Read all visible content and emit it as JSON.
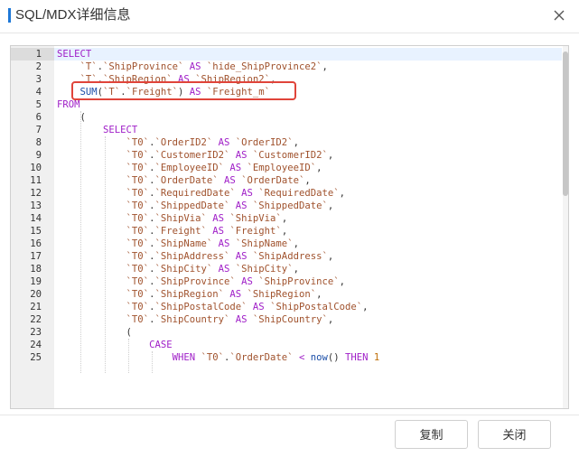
{
  "dialog": {
    "title": "SQL/MDX详细信息",
    "copy_label": "复制",
    "close_label": "关闭"
  },
  "editor": {
    "lines": [
      [
        [
          "kw",
          "SELECT"
        ]
      ],
      [
        [
          "op",
          "    "
        ],
        [
          "id",
          "`T`"
        ],
        [
          "op",
          "."
        ],
        [
          "id",
          "`ShipProvince`"
        ],
        [
          "op",
          " "
        ],
        [
          "kw",
          "AS"
        ],
        [
          "op",
          " "
        ],
        [
          "id",
          "`hide_ShipProvince2`"
        ],
        [
          "op",
          ","
        ]
      ],
      [
        [
          "op",
          "    "
        ],
        [
          "id",
          "`T`"
        ],
        [
          "op",
          "."
        ],
        [
          "id",
          "`ShipRegion`"
        ],
        [
          "op",
          " "
        ],
        [
          "kw",
          "AS"
        ],
        [
          "op",
          " "
        ],
        [
          "id",
          "`ShipRegion2`"
        ],
        [
          "op",
          ","
        ]
      ],
      [
        [
          "op",
          "    "
        ],
        [
          "fn",
          "SUM"
        ],
        [
          "op",
          "("
        ],
        [
          "id",
          "`T`"
        ],
        [
          "op",
          "."
        ],
        [
          "id",
          "`Freight`"
        ],
        [
          "op",
          ") "
        ],
        [
          "kw",
          "AS"
        ],
        [
          "op",
          " "
        ],
        [
          "id",
          "`Freight_m`"
        ]
      ],
      [
        [
          "kw",
          "FROM"
        ]
      ],
      [
        [
          "op",
          "    ("
        ]
      ],
      [
        [
          "op",
          "        "
        ],
        [
          "kw",
          "SELECT"
        ]
      ],
      [
        [
          "op",
          "            "
        ],
        [
          "id",
          "`T0`"
        ],
        [
          "op",
          "."
        ],
        [
          "id",
          "`OrderID2`"
        ],
        [
          "op",
          " "
        ],
        [
          "kw",
          "AS"
        ],
        [
          "op",
          " "
        ],
        [
          "id",
          "`OrderID2`"
        ],
        [
          "op",
          ","
        ]
      ],
      [
        [
          "op",
          "            "
        ],
        [
          "id",
          "`T0`"
        ],
        [
          "op",
          "."
        ],
        [
          "id",
          "`CustomerID2`"
        ],
        [
          "op",
          " "
        ],
        [
          "kw",
          "AS"
        ],
        [
          "op",
          " "
        ],
        [
          "id",
          "`CustomerID2`"
        ],
        [
          "op",
          ","
        ]
      ],
      [
        [
          "op",
          "            "
        ],
        [
          "id",
          "`T0`"
        ],
        [
          "op",
          "."
        ],
        [
          "id",
          "`EmployeeID`"
        ],
        [
          "op",
          " "
        ],
        [
          "kw",
          "AS"
        ],
        [
          "op",
          " "
        ],
        [
          "id",
          "`EmployeeID`"
        ],
        [
          "op",
          ","
        ]
      ],
      [
        [
          "op",
          "            "
        ],
        [
          "id",
          "`T0`"
        ],
        [
          "op",
          "."
        ],
        [
          "id",
          "`OrderDate`"
        ],
        [
          "op",
          " "
        ],
        [
          "kw",
          "AS"
        ],
        [
          "op",
          " "
        ],
        [
          "id",
          "`OrderDate`"
        ],
        [
          "op",
          ","
        ]
      ],
      [
        [
          "op",
          "            "
        ],
        [
          "id",
          "`T0`"
        ],
        [
          "op",
          "."
        ],
        [
          "id",
          "`RequiredDate`"
        ],
        [
          "op",
          " "
        ],
        [
          "kw",
          "AS"
        ],
        [
          "op",
          " "
        ],
        [
          "id",
          "`RequiredDate`"
        ],
        [
          "op",
          ","
        ]
      ],
      [
        [
          "op",
          "            "
        ],
        [
          "id",
          "`T0`"
        ],
        [
          "op",
          "."
        ],
        [
          "id",
          "`ShippedDate`"
        ],
        [
          "op",
          " "
        ],
        [
          "kw",
          "AS"
        ],
        [
          "op",
          " "
        ],
        [
          "id",
          "`ShippedDate`"
        ],
        [
          "op",
          ","
        ]
      ],
      [
        [
          "op",
          "            "
        ],
        [
          "id",
          "`T0`"
        ],
        [
          "op",
          "."
        ],
        [
          "id",
          "`ShipVia`"
        ],
        [
          "op",
          " "
        ],
        [
          "kw",
          "AS"
        ],
        [
          "op",
          " "
        ],
        [
          "id",
          "`ShipVia`"
        ],
        [
          "op",
          ","
        ]
      ],
      [
        [
          "op",
          "            "
        ],
        [
          "id",
          "`T0`"
        ],
        [
          "op",
          "."
        ],
        [
          "id",
          "`Freight`"
        ],
        [
          "op",
          " "
        ],
        [
          "kw",
          "AS"
        ],
        [
          "op",
          " "
        ],
        [
          "id",
          "`Freight`"
        ],
        [
          "op",
          ","
        ]
      ],
      [
        [
          "op",
          "            "
        ],
        [
          "id",
          "`T0`"
        ],
        [
          "op",
          "."
        ],
        [
          "id",
          "`ShipName`"
        ],
        [
          "op",
          " "
        ],
        [
          "kw",
          "AS"
        ],
        [
          "op",
          " "
        ],
        [
          "id",
          "`ShipName`"
        ],
        [
          "op",
          ","
        ]
      ],
      [
        [
          "op",
          "            "
        ],
        [
          "id",
          "`T0`"
        ],
        [
          "op",
          "."
        ],
        [
          "id",
          "`ShipAddress`"
        ],
        [
          "op",
          " "
        ],
        [
          "kw",
          "AS"
        ],
        [
          "op",
          " "
        ],
        [
          "id",
          "`ShipAddress`"
        ],
        [
          "op",
          ","
        ]
      ],
      [
        [
          "op",
          "            "
        ],
        [
          "id",
          "`T0`"
        ],
        [
          "op",
          "."
        ],
        [
          "id",
          "`ShipCity`"
        ],
        [
          "op",
          " "
        ],
        [
          "kw",
          "AS"
        ],
        [
          "op",
          " "
        ],
        [
          "id",
          "`ShipCity`"
        ],
        [
          "op",
          ","
        ]
      ],
      [
        [
          "op",
          "            "
        ],
        [
          "id",
          "`T0`"
        ],
        [
          "op",
          "."
        ],
        [
          "id",
          "`ShipProvince`"
        ],
        [
          "op",
          " "
        ],
        [
          "kw",
          "AS"
        ],
        [
          "op",
          " "
        ],
        [
          "id",
          "`ShipProvince`"
        ],
        [
          "op",
          ","
        ]
      ],
      [
        [
          "op",
          "            "
        ],
        [
          "id",
          "`T0`"
        ],
        [
          "op",
          "."
        ],
        [
          "id",
          "`ShipRegion`"
        ],
        [
          "op",
          " "
        ],
        [
          "kw",
          "AS"
        ],
        [
          "op",
          " "
        ],
        [
          "id",
          "`ShipRegion`"
        ],
        [
          "op",
          ","
        ]
      ],
      [
        [
          "op",
          "            "
        ],
        [
          "id",
          "`T0`"
        ],
        [
          "op",
          "."
        ],
        [
          "id",
          "`ShipPostalCode`"
        ],
        [
          "op",
          " "
        ],
        [
          "kw",
          "AS"
        ],
        [
          "op",
          " "
        ],
        [
          "id",
          "`ShipPostalCode`"
        ],
        [
          "op",
          ","
        ]
      ],
      [
        [
          "op",
          "            "
        ],
        [
          "id",
          "`T0`"
        ],
        [
          "op",
          "."
        ],
        [
          "id",
          "`ShipCountry`"
        ],
        [
          "op",
          " "
        ],
        [
          "kw",
          "AS"
        ],
        [
          "op",
          " "
        ],
        [
          "id",
          "`ShipCountry`"
        ],
        [
          "op",
          ","
        ]
      ],
      [
        [
          "op",
          "            ("
        ]
      ],
      [
        [
          "op",
          "                "
        ],
        [
          "kw",
          "CASE"
        ]
      ],
      [
        [
          "op",
          "                    "
        ],
        [
          "kw",
          "WHEN"
        ],
        [
          "op",
          " "
        ],
        [
          "id",
          "`T0`"
        ],
        [
          "op",
          "."
        ],
        [
          "id",
          "`OrderDate`"
        ],
        [
          "op",
          " "
        ],
        [
          "kw",
          "<"
        ],
        [
          "op",
          " "
        ],
        [
          "fn",
          "now"
        ],
        [
          "op",
          "() "
        ],
        [
          "kw",
          "THEN"
        ],
        [
          "op",
          " "
        ],
        [
          "num",
          "1"
        ]
      ]
    ]
  }
}
